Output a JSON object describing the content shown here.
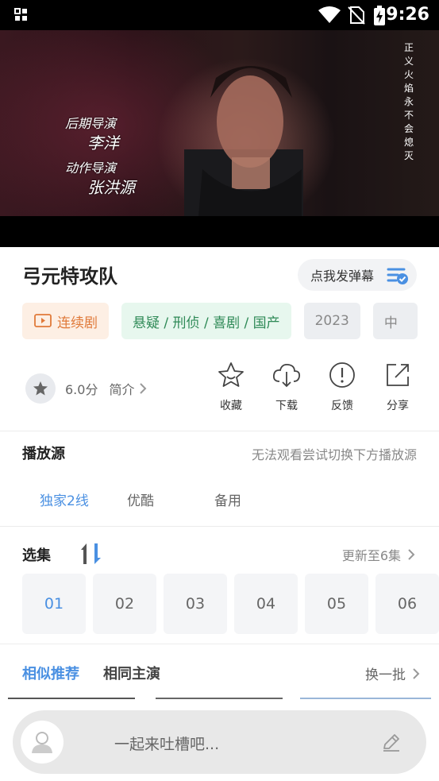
{
  "status_bar": {
    "time": "9:26"
  },
  "video": {
    "credit1_role": "后期导演",
    "credit1_name": "李洋",
    "credit2_role": "动作导演",
    "credit2_name": "张洪源",
    "side_text": "正义火焰永不会熄灭"
  },
  "show": {
    "title": "弓元特攻队",
    "danmaku_label": "点我发弹幕",
    "tags": {
      "type": "连续剧",
      "genre": "悬疑 / 刑侦 / 喜剧 / 国产",
      "year": "2023",
      "lang": "中"
    },
    "score": "6.0分",
    "intro_label": "简介"
  },
  "actions": [
    {
      "label": "收藏",
      "icon": "star-outline-icon"
    },
    {
      "label": "下载",
      "icon": "cloud-download-icon"
    },
    {
      "label": "反馈",
      "icon": "exclamation-circle-icon"
    },
    {
      "label": "分享",
      "icon": "share-icon"
    }
  ],
  "source_section": {
    "title": "播放源",
    "hint": "无法观看尝试切换下方播放源",
    "sources": [
      "独家2线",
      "优酷",
      "备用"
    ],
    "active_index": 0
  },
  "episode_section": {
    "title": "选集",
    "update_text": "更新至6集",
    "episodes": [
      "01",
      "02",
      "03",
      "04",
      "05",
      "06"
    ],
    "active_index": 0
  },
  "recommend": {
    "tabs": [
      "相似推荐",
      "相同主演"
    ],
    "active_index": 0,
    "refresh_label": "换一批"
  },
  "comment": {
    "placeholder": "一起来吐槽吧..."
  },
  "colors": {
    "accent": "#4a90e2",
    "series_tag": "#e07a3a",
    "genre_tag": "#2f8a57"
  }
}
